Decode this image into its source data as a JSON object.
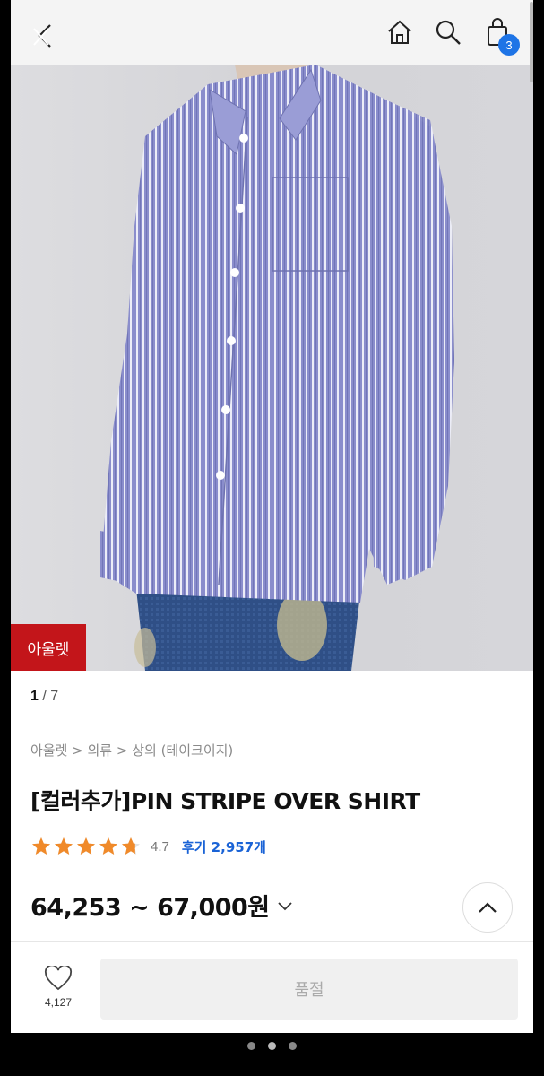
{
  "header": {
    "back_icon": "back-chevron-icon",
    "home_icon": "home-icon",
    "search_icon": "search-icon",
    "cart_icon": "shopping-bag-icon",
    "cart_count": "3",
    "accent": "#1e74e6"
  },
  "product_image": {
    "tag": "아울렛",
    "tag_color": "#c3151a"
  },
  "pager": {
    "current": "1",
    "total": "/ 7"
  },
  "breadcrumb": "아울렛 > 의류 > 상의 (테이크이지)",
  "product": {
    "title": "[컬러추가]PIN STRIPE OVER SHIRT",
    "rating": "4.7",
    "rating_stars": 4.7,
    "review_label": "후기 2,957개",
    "price": "64,253 ~ 67,000원"
  },
  "bottom_bar": {
    "wish_count": "4,127",
    "soldout_label": "품절"
  },
  "page_dots": {
    "count": 3,
    "active_index": 1
  },
  "colors": {
    "star": "#f08a2a",
    "review_link": "#1a63d6"
  }
}
